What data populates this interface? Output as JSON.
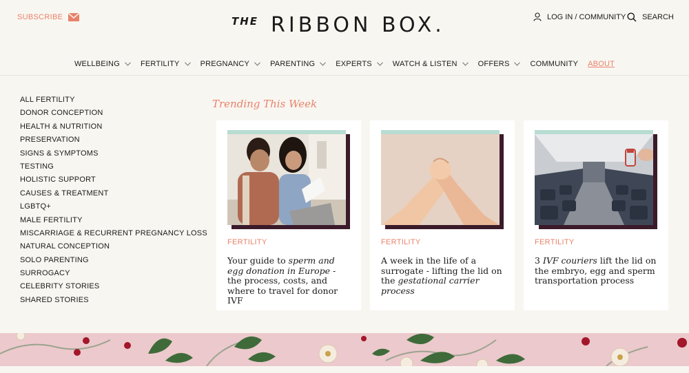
{
  "header": {
    "subscribe_label": "SUBSCRIBE",
    "logo_the": "THE",
    "logo_main": "RIBBON BOX.",
    "account_label": "LOG IN / COMMUNITY",
    "search_label": "SEARCH"
  },
  "nav": {
    "items": [
      {
        "label": "WELLBEING",
        "dropdown": true
      },
      {
        "label": "FERTILITY",
        "dropdown": true
      },
      {
        "label": "PREGNANCY",
        "dropdown": true
      },
      {
        "label": "PARENTING",
        "dropdown": true
      },
      {
        "label": "EXPERTS",
        "dropdown": true
      },
      {
        "label": "WATCH & LISTEN",
        "dropdown": true
      },
      {
        "label": "OFFERS",
        "dropdown": true
      },
      {
        "label": "COMMUNITY",
        "dropdown": false
      },
      {
        "label": "ABOUT",
        "dropdown": false
      }
    ]
  },
  "sidebar": {
    "items": [
      "ALL FERTILITY",
      "DONOR CONCEPTION",
      "HEALTH & NUTRITION",
      "PRESERVATION",
      "SIGNS & SYMPTOMS",
      "TESTING",
      "HOLISTIC SUPPORT",
      "CAUSES & TREATMENT",
      "LGBTQ+",
      "MALE FERTILITY",
      "MISCARRIAGE & RECURRENT PREGNANCY LOSS",
      "NATURAL CONCEPTION",
      "SOLO PARENTING",
      "SURROGACY",
      "CELEBRITY STORIES",
      "SHARED STORIES"
    ]
  },
  "trending": {
    "title": "Trending This Week",
    "cards": [
      {
        "category": "FERTILITY",
        "headline": {
          "a": "Your guide to ",
          "b": "sperm and egg donation in Europe",
          "c": " - the process, costs, and where to travel for donor IVF"
        }
      },
      {
        "category": "FERTILITY",
        "headline": {
          "a": "A week in the life of a surrogate - lifting the lid on the ",
          "b": "gestational carrier process",
          "c": ""
        }
      },
      {
        "category": "FERTILITY",
        "headline": {
          "a": "3 ",
          "b": "IVF couriers",
          "c": " lift the lid on the embryo, egg and sperm transportation process"
        }
      }
    ]
  },
  "colors": {
    "accent": "#e8826a",
    "background": "#f8f6f1",
    "card_mint": "#b8dcd2",
    "card_shadow": "#3b1a2a",
    "floral_bg": "#ecc9cc"
  }
}
